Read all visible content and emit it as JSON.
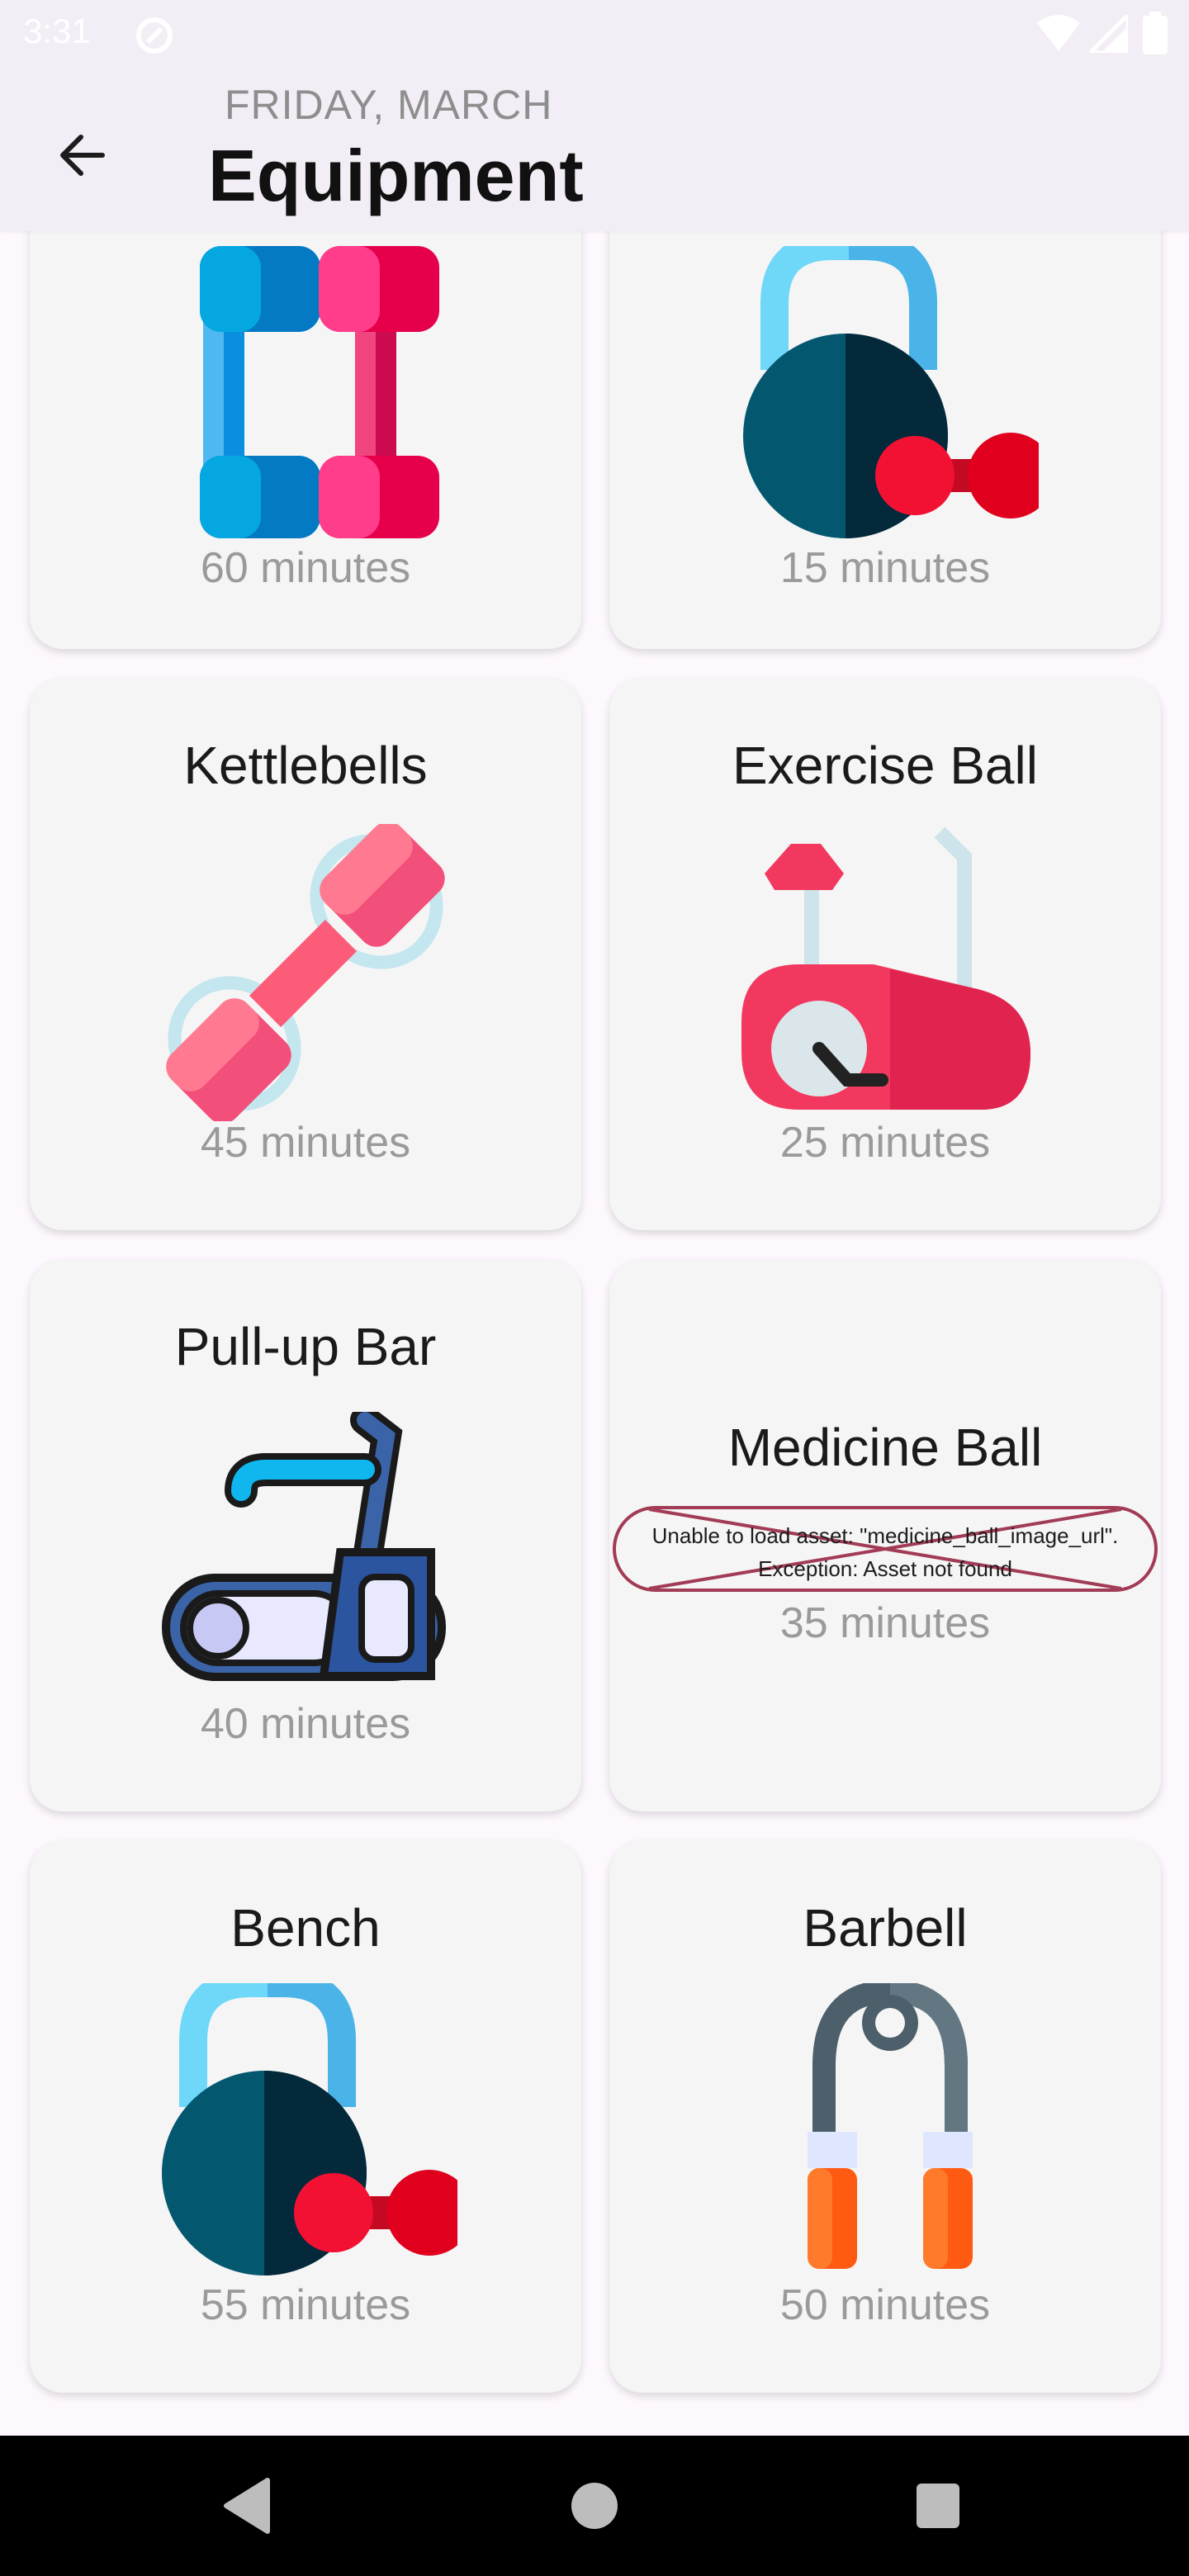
{
  "status_bar": {
    "time": "3:31"
  },
  "app_bar": {
    "subtitle": "FRIDAY, MARCH",
    "title": "Equipment"
  },
  "items": [
    {
      "name": "",
      "duration": "60 minutes",
      "image": "dumbbells"
    },
    {
      "name": "",
      "duration": "15 minutes",
      "image": "kettlebell-dumbbell"
    },
    {
      "name": "Kettlebells",
      "duration": "45 minutes",
      "image": "dumbbell"
    },
    {
      "name": "Exercise Ball",
      "duration": "25 minutes",
      "image": "exercise-bike"
    },
    {
      "name": "Pull-up Bar",
      "duration": "40 minutes",
      "image": "treadmill"
    },
    {
      "name": "Medicine Ball",
      "duration": "35 minutes",
      "error_line1": "Unable to load asset: \"medicine_ball_image_url\".",
      "error_line2": "Exception: Asset not found"
    },
    {
      "name": "Bench",
      "duration": "55 minutes",
      "image": "kettlebell-dumbbell"
    },
    {
      "name": "Barbell",
      "duration": "50 minutes",
      "image": "jump-rope"
    }
  ],
  "colors": {
    "app_bar_bg": "#f3eef6",
    "card_bg": "#f5f5f5",
    "error_border": "#a23b55"
  }
}
